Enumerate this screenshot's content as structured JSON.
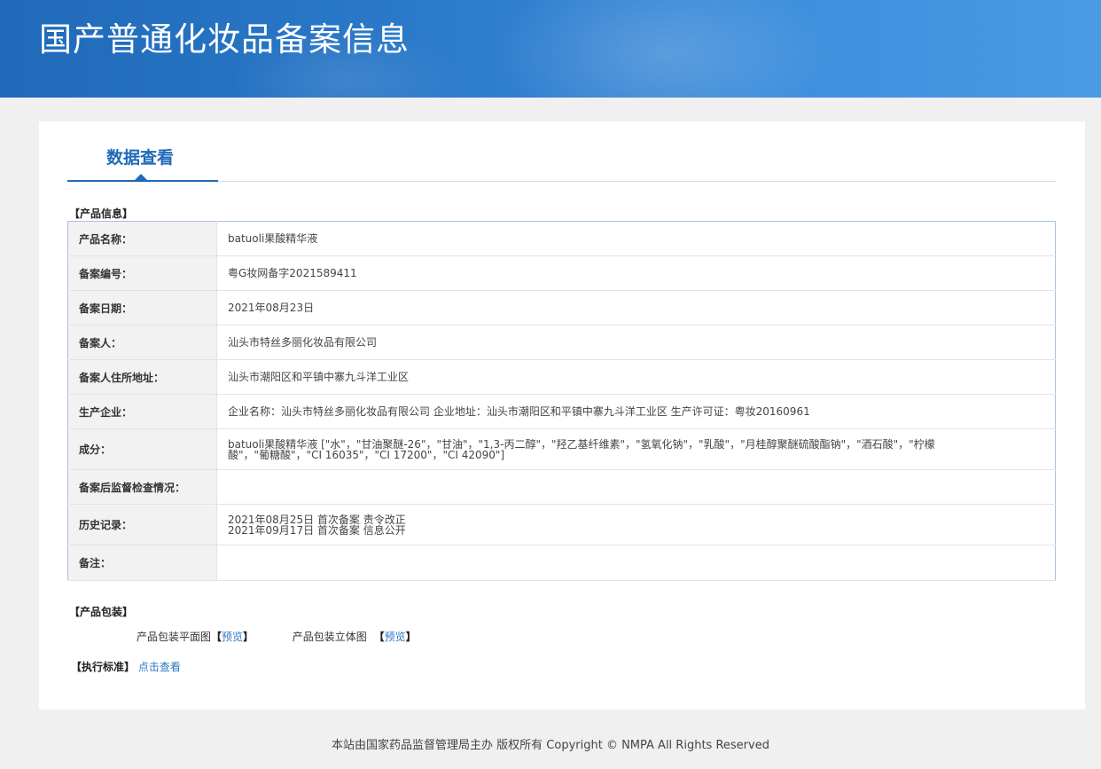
{
  "header": {
    "title": "国产普通化妆品备案信息"
  },
  "tab": {
    "label": "数据查看"
  },
  "product_info": {
    "heading": "【产品信息】",
    "rows": [
      {
        "key": "产品名称：",
        "value": "batuoli果酸精华液"
      },
      {
        "key": "备案编号：",
        "value": "粤G妆网备字2021589411"
      },
      {
        "key": "备案日期：",
        "value": "2021年08月23日"
      },
      {
        "key": "备案人：",
        "value": "汕头市特丝多丽化妆品有限公司"
      },
      {
        "key": "备案人住所地址：",
        "value": "汕头市潮阳区和平镇中寨九斗洋工业区"
      },
      {
        "key": "生产企业：",
        "value": "企业名称：汕头市特丝多丽化妆品有限公司 企业地址：汕头市潮阳区和平镇中寨九斗洋工业区 生产许可证：粤妆20160961"
      },
      {
        "key": "成分：",
        "value_lines": [
          "batuoli果酸精华液 [\"水\"，\"甘油聚醚-26\"，\"甘油\"，\"1,3-丙二醇\"，\"羟乙基纤维素\"，\"氢氧化钠\"，\"乳酸\"，\"月桂醇聚醚硫酸酯钠\"，\"酒石酸\"，\"柠檬",
          "酸\"，\"葡糖酸\"，\"CI 16035\"，\"CI 17200\"，\"CI 42090\"]"
        ]
      },
      {
        "key": "备案后监督检查情况：",
        "value": ""
      },
      {
        "key": "历史记录：",
        "value_lines": [
          "2021年08月25日 首次备案 责令改正",
          "2021年09月17日 首次备案 信息公开"
        ]
      },
      {
        "key": "备注：",
        "value": ""
      }
    ]
  },
  "packaging": {
    "heading": "【产品包装】",
    "flat_label": "产品包装平面图",
    "three_d_label": "产品包装立体图",
    "bracket_open": "【",
    "bracket_close": "】",
    "preview": "预览"
  },
  "standard": {
    "heading": "【执行标准】",
    "link": "点击查看"
  },
  "footer": {
    "text": "本站由国家药品监督管理局主办 版权所有 Copyright © NMPA All Rights Reserved"
  }
}
